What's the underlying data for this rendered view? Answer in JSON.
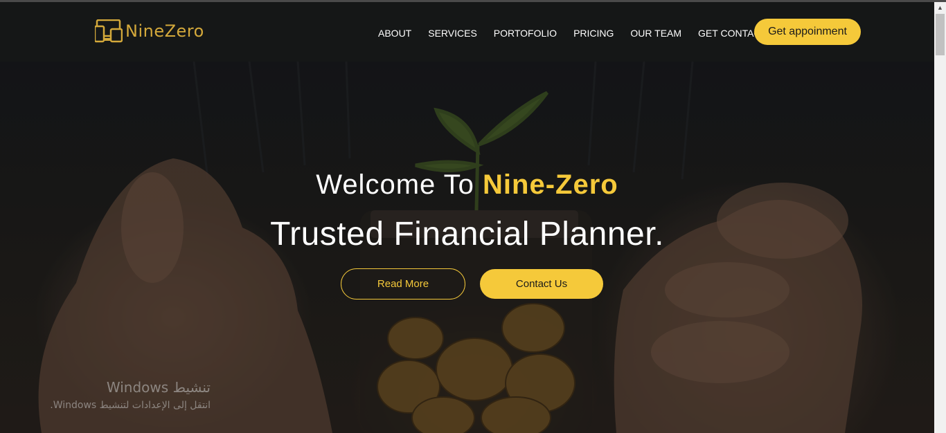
{
  "brand": {
    "name": "NineZero",
    "logo_icon": "devices-icon",
    "color": "#d4a93b"
  },
  "nav": {
    "links": [
      "ABOUT",
      "SERVICES",
      "PORTOFOLIO",
      "PRICING",
      "OUR TEAM",
      "GET CONTACT"
    ],
    "cta_label": "Get appoinment"
  },
  "hero": {
    "welcome_prefix": "Welcome To ",
    "welcome_brand": "Nine-Zero",
    "subtitle": "Trusted Financial Planner.",
    "read_more_label": "Read More",
    "contact_label": "Contact Us"
  },
  "os_watermark": {
    "title": "تنشيط Windows",
    "subtitle": "انتقل إلى الإعدادات لتنشيط Windows."
  },
  "colors": {
    "accent": "#f5c93a",
    "navbar_bg": "#151717",
    "text": "#ffffff"
  }
}
